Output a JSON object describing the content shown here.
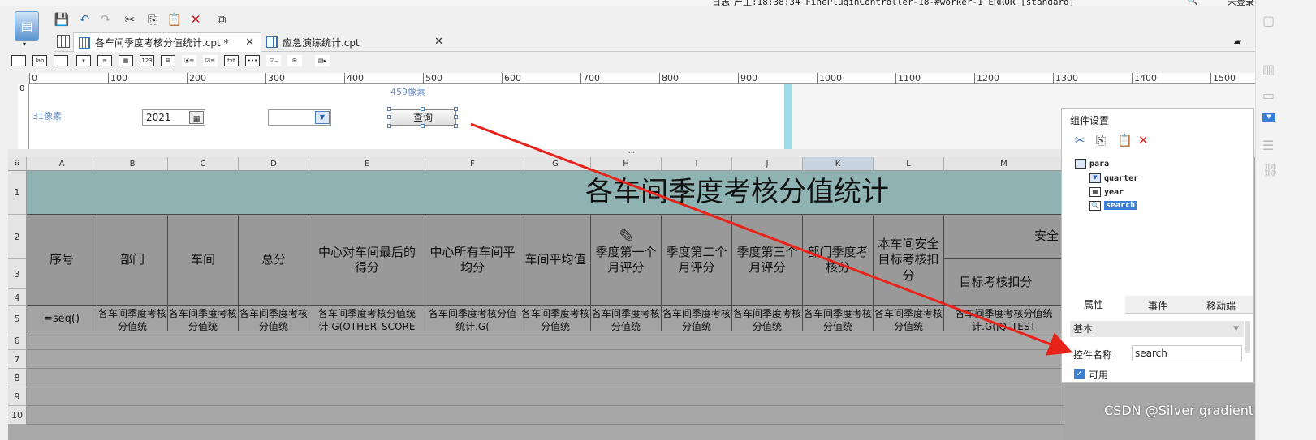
{
  "status_bar": {
    "log_label": "日志",
    "log_text": "产生:18:38:34 FinePluginController-18-#worker-1 ERROR [standard]",
    "user": "未登录"
  },
  "tabs": [
    {
      "label": "各车间季度考核分值统计.cpt *",
      "active": true
    },
    {
      "label": "应急演练统计.cpt",
      "active": false
    }
  ],
  "ruler": {
    "ticks": [
      "0",
      "100",
      "200",
      "300",
      "400",
      "500",
      "600",
      "700",
      "800",
      "900",
      "1000",
      "1100",
      "1200",
      "1300",
      "1400",
      "1500"
    ],
    "vzero": "0"
  },
  "param_pane": {
    "height_label": "31像素",
    "width_label": "459像素",
    "year_value": "2021",
    "quarter_value": "",
    "query_label": "查询"
  },
  "sheet": {
    "columns": [
      "A",
      "B",
      "C",
      "D",
      "E",
      "F",
      "G",
      "H",
      "I",
      "J",
      "K",
      "L",
      "M"
    ],
    "selected_column": "K",
    "rows": [
      "1",
      "2",
      "3",
      "4",
      "5",
      "6",
      "7",
      "8",
      "9",
      "10"
    ],
    "title": "各车间季度考核分值统计",
    "headers": [
      "序号",
      "部门",
      "车间",
      "总分",
      "中心对车间最后的得分",
      "中心所有车间平均分",
      "车间平均值",
      "季度第一个月评分",
      "季度第二个月评分",
      "季度第三个月评分",
      "部门季度考核分",
      "本车间安全目标考核扣分"
    ],
    "group_header": "安全",
    "sub_header": "目标考核扣分",
    "formulas": [
      "=seq()",
      "各车间季度考核分值统",
      "各车间季度考核分值统",
      "各车间季度考核分值统",
      "各车间季度考核分值统计.G(OTHER_SCORE",
      "各车间季度考核分值统计.G(",
      "各车间季度考核分值统",
      "各车间季度考核分值统",
      "各车间季度考核分值统",
      "各车间季度考核分值统",
      "各车间季度考核分值统",
      "各车间季度考核分值统",
      "各车间季度考核分值统计.G(JQ_TEST"
    ]
  },
  "panel": {
    "title": "组件设置",
    "tree": [
      "para",
      "quarter",
      "year",
      "search"
    ],
    "selected": "search",
    "tabs": [
      "属性",
      "事件",
      "移动端"
    ],
    "section": "基本",
    "name_label": "控件名称",
    "name_value": "search",
    "enabled_label": "可用"
  },
  "watermark": "CSDN @Silver gradient",
  "colors": {
    "title_bg": "#8fb2b2",
    "cell_bg": "#999999",
    "selection": "#3a7fd5",
    "arrow": "#e8231a"
  }
}
